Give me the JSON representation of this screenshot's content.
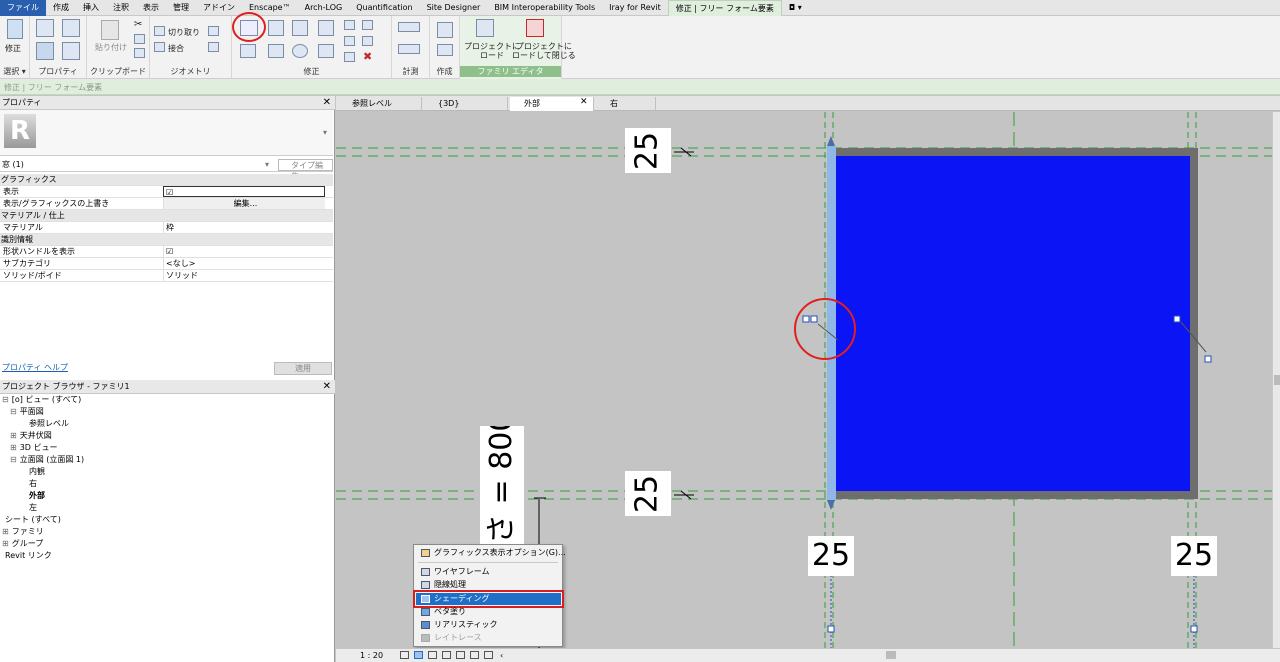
{
  "menu_tabs": [
    "ファイル",
    "作成",
    "挿入",
    "注釈",
    "表示",
    "管理",
    "アドイン",
    "Enscape™",
    "Arch-LOG",
    "Quantification",
    "Site Designer",
    "BIM Interoperability Tools",
    "Iray for Revit",
    "修正 | フリー フォーム要素"
  ],
  "ribbon": {
    "modify_label": "修正",
    "paste_label": "貼り付け",
    "cut_label": "切り取り",
    "join_label": "接合",
    "load_project": "プロジェクトに\nロード",
    "load_close": "プロジェクトに\nロードして閉じる",
    "groups": [
      "選択 ▾",
      "プロパティ",
      "クリップボード",
      "ジオメトリ",
      "修正",
      "計測",
      "作成",
      "ファミリ エディタ"
    ]
  },
  "context_bar": "修正 | フリー フォーム要素",
  "properties": {
    "title": "プロパティ",
    "type_selector": "窓 (1)",
    "edit_type": "タイプ編集",
    "rows": [
      {
        "cat": "グラフィックス"
      },
      {
        "key": "表示",
        "val": "☑"
      },
      {
        "key": "表示/グラフィックスの上書き",
        "val": "編集..."
      },
      {
        "cat": "マテリアル / 仕上"
      },
      {
        "key": "マテリアル",
        "val": "枠"
      },
      {
        "cat": "識別情報"
      },
      {
        "key": "形状ハンドルを表示",
        "val": "☑"
      },
      {
        "key": "サブカテゴリ",
        "val": "<なし>"
      },
      {
        "key": "ソリッド/ボイド",
        "val": "ソリッド"
      }
    ],
    "help_link": "プロパティ ヘルプ",
    "apply": "適用"
  },
  "browser": {
    "title": "プロジェクト ブラウザ - ファミリ1",
    "items": [
      {
        "text": "[o] ビュー (すべて)",
        "indent": 0,
        "toggle": "⊟"
      },
      {
        "text": "平面図",
        "indent": 1,
        "toggle": "⊟"
      },
      {
        "text": "参照レベル",
        "indent": 3,
        "toggle": ""
      },
      {
        "text": "天井伏図",
        "indent": 1,
        "toggle": "⊞"
      },
      {
        "text": "3D ビュー",
        "indent": 1,
        "toggle": "⊞"
      },
      {
        "text": "立面図 (立面図 1)",
        "indent": 1,
        "toggle": "⊟"
      },
      {
        "text": "内観",
        "indent": 3,
        "toggle": ""
      },
      {
        "text": "右",
        "indent": 3,
        "toggle": ""
      },
      {
        "text": "外部",
        "indent": 3,
        "toggle": "",
        "bold": true
      },
      {
        "text": "左",
        "indent": 3,
        "toggle": ""
      },
      {
        "text": "シート (すべて)",
        "indent": 0,
        "toggle": ""
      },
      {
        "text": "ファミリ",
        "indent": 0,
        "toggle": "⊞"
      },
      {
        "text": "グループ",
        "indent": 0,
        "toggle": "⊞"
      },
      {
        "text": "Revit リンク",
        "indent": 0,
        "toggle": ""
      }
    ]
  },
  "view_tabs": [
    "参照レベル",
    "{3D}",
    "外部",
    "右"
  ],
  "active_view": "外部",
  "dimensions": {
    "top_left": "25",
    "mid_left": "25",
    "bottom_a": "25",
    "bottom_b": "25",
    "vertical": "= 800",
    "vertical_prefix": "さ"
  },
  "context_menu": [
    {
      "label": "グラフィックス表示オプション(G)...",
      "state": "normal"
    },
    {
      "label": "ワイヤフレーム",
      "state": "normal"
    },
    {
      "label": "隠線処理",
      "state": "normal"
    },
    {
      "label": "シェーディング",
      "state": "selected"
    },
    {
      "label": "ベタ塗り",
      "state": "normal"
    },
    {
      "label": "リアリスティック",
      "state": "normal"
    },
    {
      "label": "レイトレース",
      "state": "disabled"
    }
  ],
  "status": {
    "scale": "1 : 20"
  },
  "colors": {
    "fill": "#0a14f5",
    "frame": "#6e6e6e",
    "highlight": "#e02020",
    "guide": "#2f9e3a"
  }
}
